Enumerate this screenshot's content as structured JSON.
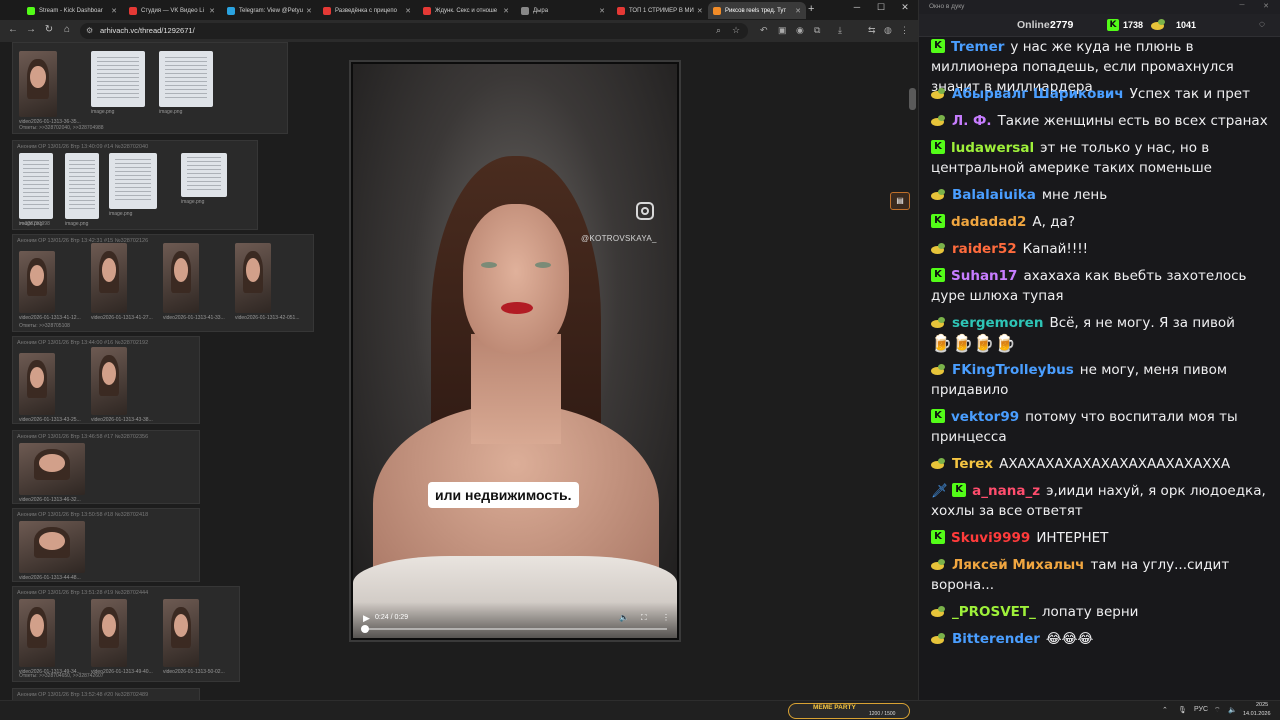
{
  "browser": {
    "tabs": [
      {
        "title": "Stream - Kick Dashboar",
        "color": "#53fc18"
      },
      {
        "title": "Студия — VK Видео Li",
        "color": "#e53935"
      },
      {
        "title": "Telegram: View @Petyu",
        "color": "#2aa3e0"
      },
      {
        "title": "Разведёнка с прицепо",
        "color": "#e53935"
      },
      {
        "title": "Ждунк. Секс и отноше",
        "color": "#e53935"
      },
      {
        "title": "Дыра",
        "color": "#888888"
      },
      {
        "title": "ТОП 1 СТРИМЕР В МИ",
        "color": "#e53935"
      },
      {
        "title": "Риксов reels тред. Тут",
        "color": "#f28c28"
      }
    ],
    "new_tab": "+",
    "address": "arhivach.vc/thread/1292671/"
  },
  "thread": {
    "posts": [
      {
        "head": "",
        "thumbs": [
          "video2026-01-1313-36-35...",
          "image.png",
          "image.png"
        ],
        "replies": "Ответы: >>328702040, >>328704988"
      },
      {
        "head": "Аноним OP 13/01/26 Втр 13:40:09 #14 №328702040",
        "thumbs": [
          "image.png",
          "image.png",
          "image.png",
          "image.png"
        ],
        "replies": ">>328701998"
      },
      {
        "head": "Аноним OP 13/01/26 Втр 13:42:31 #15 №328702126",
        "thumbs": [
          "video2026-01-1313-41-12...",
          "video2026-01-1313-41-27...",
          "video2026-01-1313-41-33...",
          "video2026-01-1313-42-051..."
        ],
        "replies": "Ответы: >>328705108"
      },
      {
        "head": "Аноним OP 13/01/26 Втр 13:44:00 #16 №328702192",
        "thumbs": [
          "video2026-01-1313-43-25...",
          "video2026-01-1313-43-38..."
        ],
        "replies": ""
      },
      {
        "head": "Аноним OP 13/01/26 Втр 13:46:58 #17 №328702356",
        "thumbs": [
          "video2026-01-1313-46-32..."
        ],
        "replies": ""
      },
      {
        "head": "Аноним OP 13/01/26 Втр 13:50:58 #18 №328702418",
        "thumbs": [
          "video2026-01-1313-44-48..."
        ],
        "replies": ""
      },
      {
        "head": "Аноним OP 13/01/26 Втр 13:51:28 #19 №328702444",
        "thumbs": [
          "video2026-01-1313-49-34...",
          "video2026-01-1313-49-40...",
          "video2026-01-1313-50-02..."
        ],
        "replies": "Ответы: >>328704650, >>328742607"
      },
      {
        "head": "Аноним OP 13/01/26 Втр 13:52:48 #20 №328702489",
        "thumbs": [],
        "replies": ""
      }
    ]
  },
  "player": {
    "watermark": "@KOTROVSKAYA_",
    "subtitle": "или недвижимость.",
    "time": "0:24 / 0:29",
    "progress": 0.0
  },
  "chat": {
    "window_title": "Окно в дуку",
    "online_label": "Online:",
    "online_count": "2779",
    "kick_count": "1738",
    "bean_count": "1041",
    "messages": [
      {
        "badge": "kick",
        "user": "Tremer",
        "color": "#4a9eff",
        "text": "у нас же куда не плюнь в миллионера попадешь, если промахнулся значит в миллиардера"
      },
      {
        "badge": "bean",
        "user": "Абырвалг Шарикович",
        "color": "#4a9eff",
        "text": "Успех так и прет"
      },
      {
        "badge": "bean",
        "user": "Л. Ф.",
        "color": "#c77dff",
        "text": "Такие женщины есть во всех странах"
      },
      {
        "badge": "kick",
        "user": "ludawersal",
        "color": "#9ef03a",
        "text": "эт не только у нас, но в центральной америке таких поменьше"
      },
      {
        "badge": "bean",
        "user": "Balalaiuika",
        "color": "#4a9eff",
        "text": "мне лень"
      },
      {
        "badge": "kick",
        "user": "dadadad2",
        "color": "#f0a640",
        "text": "А, да?"
      },
      {
        "badge": "bean",
        "user": "raider52",
        "color": "#ff6b3d",
        "text": "Капай!!!!"
      },
      {
        "badge": "kick",
        "user": "Suhan17",
        "color": "#c77dff",
        "text": "ахахаха как вьебть захотелось дуре шлюха тупая"
      },
      {
        "badge": "bean",
        "user": "sergemoren",
        "color": "#2ec4b6",
        "text": "Всё, я не могу. Я за пивой"
      },
      {
        "badge": "bean",
        "user": "FKingTrolleybus",
        "color": "#4a9eff",
        "text": "не могу, меня пивом придавило"
      },
      {
        "badge": "kick",
        "user": "vektor99",
        "color": "#4a9eff",
        "text": "потому что воспитали моя ты принцесса"
      },
      {
        "badge": "bean",
        "user": "Terex",
        "color": "#f5c542",
        "text": "АХАХАХАХАХАХАХАХААХАХАХХА"
      },
      {
        "badge": "sword-kick",
        "user": "a_nana_z",
        "color": "#ff4d6d",
        "text": "э,ииди нахуй, я орк людоедка, хохлы за все ответят"
      },
      {
        "badge": "kick",
        "user": "Skuvi9999",
        "color": "#ff3b3b",
        "text": "ИНТЕРНЕТ"
      },
      {
        "badge": "bean",
        "user": "Ляксей Михалыч",
        "color": "#f0a640",
        "text": "там на углу...сидит ворона..."
      },
      {
        "badge": "bean",
        "user": "_PROSVET_",
        "color": "#9ef03a",
        "text": "лопату верни"
      },
      {
        "badge": "bean",
        "user": "Bitterender",
        "color": "#4a9eff",
        "text": "😂😂😂"
      }
    ]
  },
  "taskbar": {
    "meme_label": "MEME PARTY",
    "meme_count": "1200 / 1500",
    "lang": "РУС",
    "time": "2025",
    "date": "14.01.2026"
  }
}
